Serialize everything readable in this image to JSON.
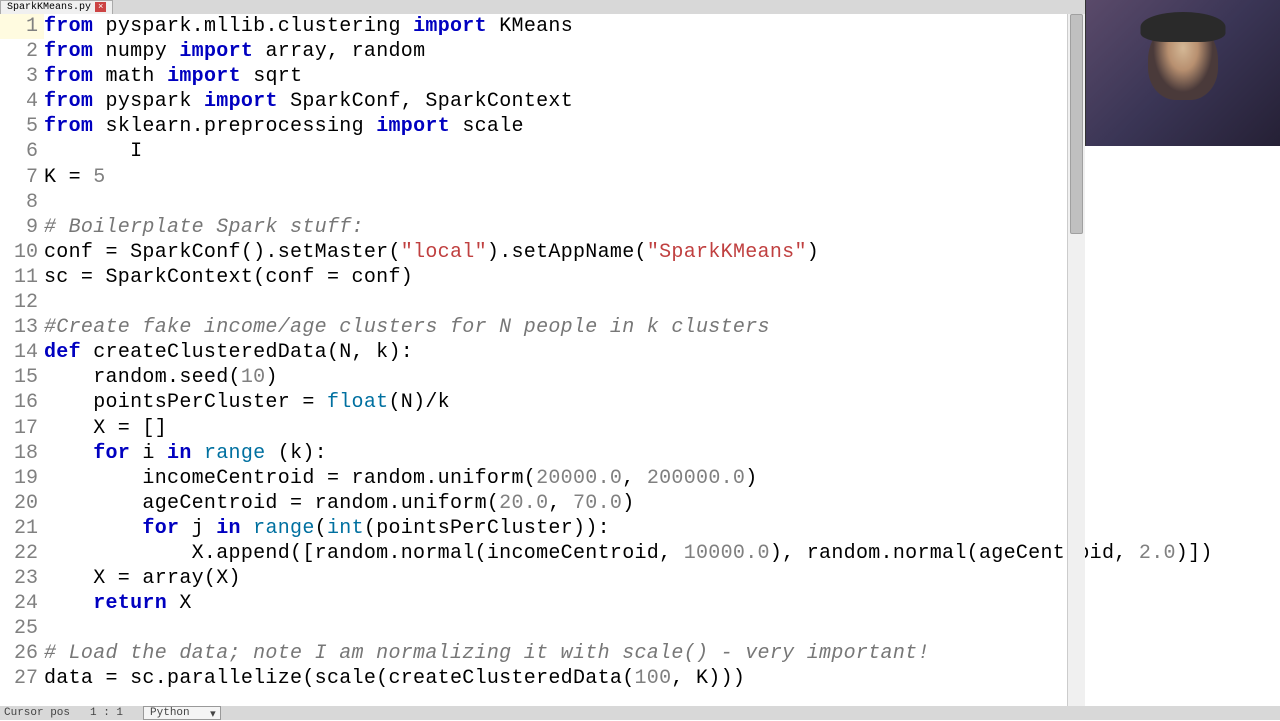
{
  "tab": {
    "filename": "SparkKMeans.py",
    "close": "×"
  },
  "status": {
    "label": "Cursor pos",
    "pos": "1 : 1",
    "language": "Python"
  },
  "lines": [
    {
      "n": "1",
      "tokens": [
        [
          "kw",
          "from"
        ],
        [
          "",
          " "
        ],
        [
          "",
          "pyspark.mllib.clustering"
        ],
        [
          "",
          " "
        ],
        [
          "kw",
          "import"
        ],
        [
          "",
          " "
        ],
        [
          "",
          "KMeans"
        ]
      ]
    },
    {
      "n": "2",
      "tokens": [
        [
          "kw",
          "from"
        ],
        [
          "",
          " "
        ],
        [
          "",
          "numpy"
        ],
        [
          "",
          " "
        ],
        [
          "kw",
          "import"
        ],
        [
          "",
          " "
        ],
        [
          "",
          "array, random"
        ]
      ]
    },
    {
      "n": "3",
      "tokens": [
        [
          "kw",
          "from"
        ],
        [
          "",
          " "
        ],
        [
          "",
          "math"
        ],
        [
          "",
          " "
        ],
        [
          "kw",
          "import"
        ],
        [
          "",
          " "
        ],
        [
          "",
          "sqrt"
        ]
      ]
    },
    {
      "n": "4",
      "tokens": [
        [
          "kw",
          "from"
        ],
        [
          "",
          " "
        ],
        [
          "",
          "pyspark"
        ],
        [
          "",
          " "
        ],
        [
          "kw",
          "import"
        ],
        [
          "",
          " "
        ],
        [
          "",
          "SparkConf, SparkContext"
        ]
      ]
    },
    {
      "n": "5",
      "tokens": [
        [
          "kw",
          "from"
        ],
        [
          "",
          " "
        ],
        [
          "",
          "sklearn.preprocessing"
        ],
        [
          "",
          " "
        ],
        [
          "kw",
          "import"
        ],
        [
          "",
          " "
        ],
        [
          "",
          "scale"
        ]
      ]
    },
    {
      "n": "6",
      "tokens": [
        [
          "",
          "       I"
        ]
      ]
    },
    {
      "n": "7",
      "tokens": [
        [
          "",
          "K = "
        ],
        [
          "num",
          "5"
        ]
      ]
    },
    {
      "n": "8",
      "tokens": [
        [
          "",
          ""
        ]
      ]
    },
    {
      "n": "9",
      "tokens": [
        [
          "com",
          "# Boilerplate Spark stuff:"
        ]
      ]
    },
    {
      "n": "10",
      "tokens": [
        [
          "",
          "conf = SparkConf().setMaster("
        ],
        [
          "str",
          "\"local\""
        ],
        [
          "",
          ").setAppName("
        ],
        [
          "str",
          "\"SparkKMeans\""
        ],
        [
          "",
          ")"
        ]
      ]
    },
    {
      "n": "11",
      "tokens": [
        [
          "",
          "sc = SparkContext(conf = conf)"
        ]
      ]
    },
    {
      "n": "12",
      "tokens": [
        [
          "",
          ""
        ]
      ]
    },
    {
      "n": "13",
      "tokens": [
        [
          "com",
          "#Create fake income/age clusters for N people in k clusters"
        ]
      ]
    },
    {
      "n": "14",
      "tokens": [
        [
          "kw",
          "def"
        ],
        [
          "",
          " "
        ],
        [
          "",
          "createClusteredData(N, k):"
        ]
      ]
    },
    {
      "n": "15",
      "tokens": [
        [
          "",
          "    random.seed("
        ],
        [
          "num",
          "10"
        ],
        [
          "",
          ")"
        ]
      ]
    },
    {
      "n": "16",
      "tokens": [
        [
          "",
          "    pointsPerCluster = "
        ],
        [
          "bi",
          "float"
        ],
        [
          "",
          "(N)/k"
        ]
      ]
    },
    {
      "n": "17",
      "tokens": [
        [
          "",
          "    X = []"
        ]
      ]
    },
    {
      "n": "18",
      "tokens": [
        [
          "",
          "    "
        ],
        [
          "kw",
          "for"
        ],
        [
          "",
          " i "
        ],
        [
          "kw",
          "in"
        ],
        [
          "",
          " "
        ],
        [
          "bi",
          "range"
        ],
        [
          "",
          " (k):"
        ]
      ]
    },
    {
      "n": "19",
      "tokens": [
        [
          "",
          "        incomeCentroid = random.uniform("
        ],
        [
          "num",
          "20000.0"
        ],
        [
          "",
          ", "
        ],
        [
          "num",
          "200000.0"
        ],
        [
          "",
          ")"
        ]
      ]
    },
    {
      "n": "20",
      "tokens": [
        [
          "",
          "        ageCentroid = random.uniform("
        ],
        [
          "num",
          "20.0"
        ],
        [
          "",
          ", "
        ],
        [
          "num",
          "70.0"
        ],
        [
          "",
          ")"
        ]
      ]
    },
    {
      "n": "21",
      "tokens": [
        [
          "",
          "        "
        ],
        [
          "kw",
          "for"
        ],
        [
          "",
          " j "
        ],
        [
          "kw",
          "in"
        ],
        [
          "",
          " "
        ],
        [
          "bi",
          "range"
        ],
        [
          "",
          "("
        ],
        [
          "bi",
          "int"
        ],
        [
          "",
          "(pointsPerCluster)):"
        ]
      ]
    },
    {
      "n": "22",
      "tokens": [
        [
          "",
          "            X.append([random.normal(incomeCentroid, "
        ],
        [
          "num",
          "10000.0"
        ],
        [
          "",
          "), random.normal(ageCentroid, "
        ],
        [
          "num",
          "2.0"
        ],
        [
          "",
          ")])"
        ]
      ]
    },
    {
      "n": "23",
      "tokens": [
        [
          "",
          "    X = array(X)"
        ]
      ]
    },
    {
      "n": "24",
      "tokens": [
        [
          "",
          "    "
        ],
        [
          "kw",
          "return"
        ],
        [
          "",
          " X"
        ]
      ]
    },
    {
      "n": "25",
      "tokens": [
        [
          "",
          ""
        ]
      ]
    },
    {
      "n": "26",
      "tokens": [
        [
          "com",
          "# Load the data; note I am normalizing it with scale() - very important!"
        ]
      ]
    },
    {
      "n": "27",
      "tokens": [
        [
          "",
          "data = sc.parallelize(scale(createClusteredData("
        ],
        [
          "num",
          "100"
        ],
        [
          "",
          ", K)))"
        ]
      ]
    }
  ]
}
